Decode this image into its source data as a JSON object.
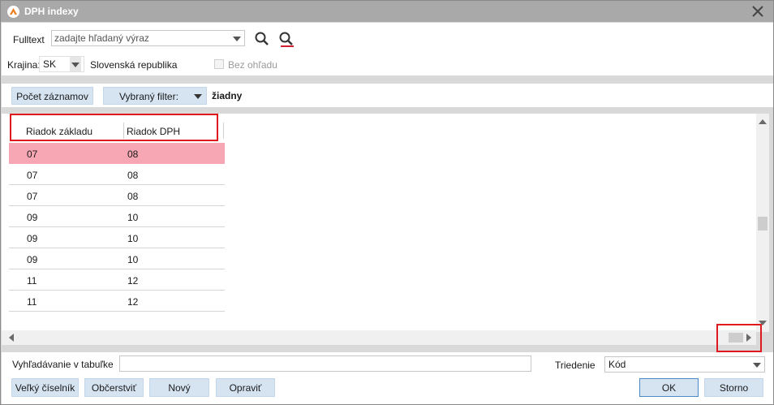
{
  "window": {
    "title": "DPH indexy"
  },
  "search": {
    "label": "Fulltext",
    "placeholder": "zadajte hľadaný výraz"
  },
  "country": {
    "label": "Krajina:",
    "code": "SK",
    "name": "Slovenská republika",
    "ignore_label": "Bez ohľadu"
  },
  "filterbar": {
    "count_button": "Počet záznamov",
    "filter_label": "Vybraný filter:",
    "filter_value": "žiadny"
  },
  "grid": {
    "columns": [
      "Riadok základu",
      "Riadok DPH"
    ],
    "rows": [
      [
        "07",
        "08"
      ],
      [
        "07",
        "08"
      ],
      [
        "07",
        "08"
      ],
      [
        "09",
        "10"
      ],
      [
        "09",
        "10"
      ],
      [
        "09",
        "10"
      ],
      [
        "11",
        "12"
      ],
      [
        "11",
        "12"
      ]
    ],
    "selected_row": 0
  },
  "bottom": {
    "table_search_label": "Vyhľadávanie v tabuľke",
    "sort_label": "Triedenie",
    "sort_value": "Kód",
    "buttons": {
      "big_list": "Veľký číselník",
      "refresh": "Občerstviť",
      "new": "Nový",
      "edit": "Opraviť",
      "ok": "OK",
      "cancel": "Storno"
    }
  },
  "colors": {
    "titlebar": "#a9a9a9",
    "selected_row": "#f7a6b3",
    "button": "#d6e4f2",
    "highlight_box": "#e0191f"
  }
}
